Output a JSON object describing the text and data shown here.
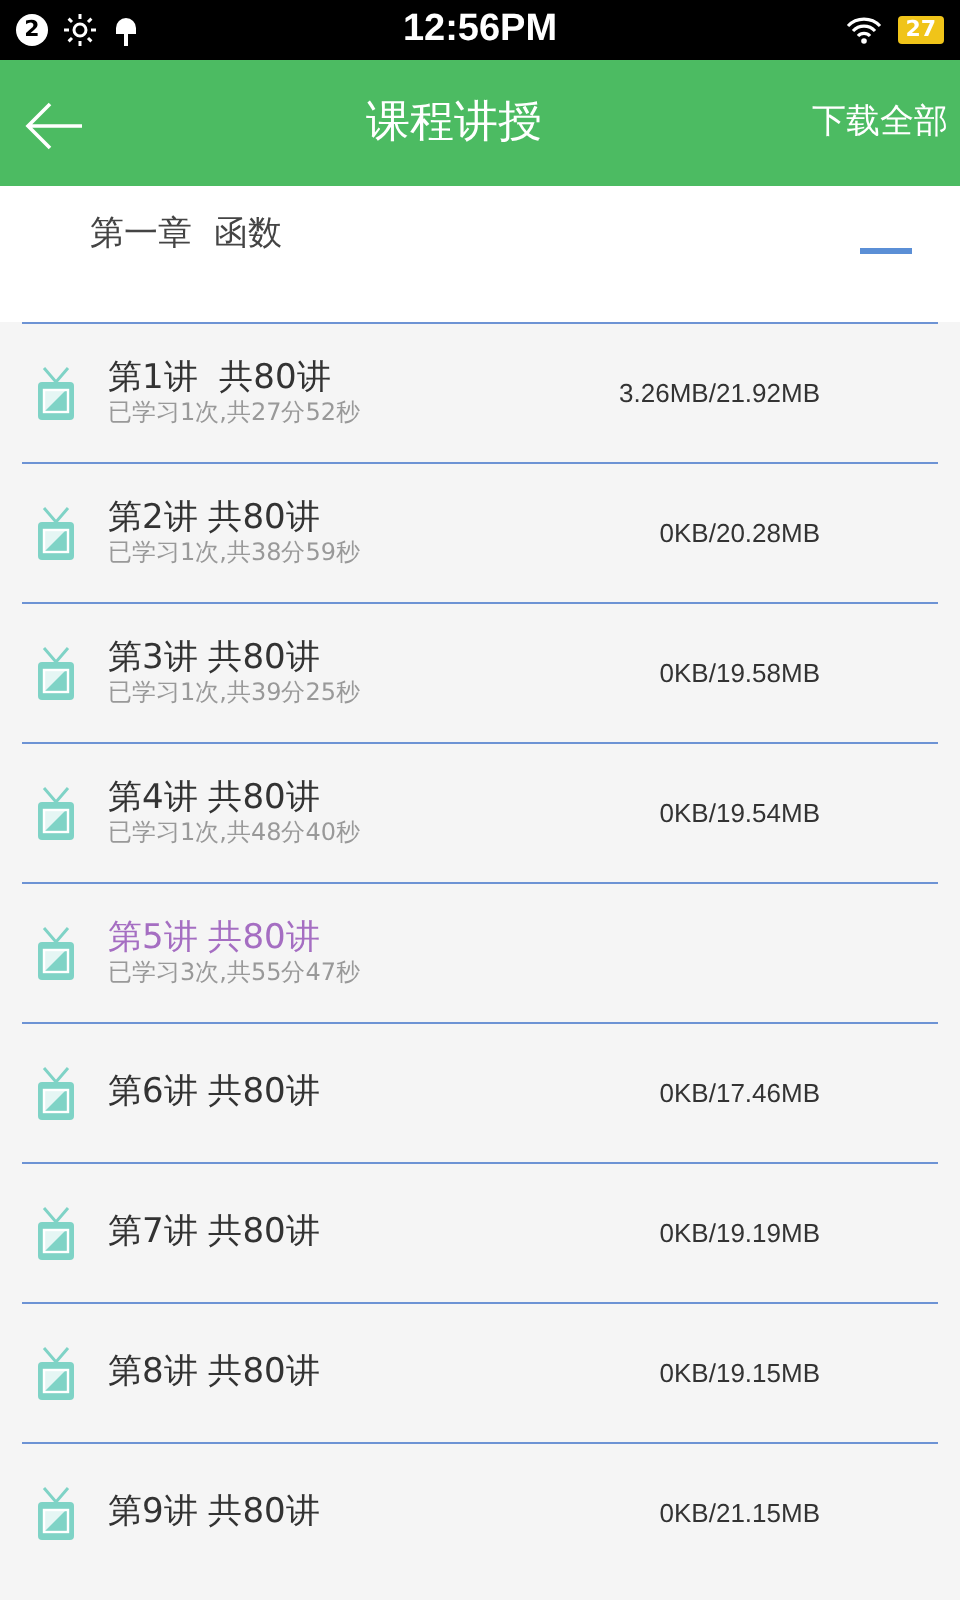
{
  "status_bar": {
    "notification_count": "2",
    "time": "12:56PM",
    "battery": "27"
  },
  "header": {
    "title": "课程讲授",
    "action": "下载全部"
  },
  "chapter": {
    "title": "第一章  函数",
    "expanded": true
  },
  "lessons": [
    {
      "title": "第1讲  共80讲",
      "progress": "已学习1次,共27分52秒",
      "size": "3.26MB/21.92MB",
      "selected": false
    },
    {
      "title": "第2讲 共80讲",
      "progress": "已学习1次,共38分59秒",
      "size": "0KB/20.28MB",
      "selected": false
    },
    {
      "title": "第3讲 共80讲",
      "progress": "已学习1次,共39分25秒",
      "size": "0KB/19.58MB",
      "selected": false
    },
    {
      "title": "第4讲 共80讲",
      "progress": "已学习1次,共48分40秒",
      "size": "0KB/19.54MB",
      "selected": false
    },
    {
      "title": "第5讲 共80讲",
      "progress": "已学习3次,共55分47秒",
      "selected": true
    },
    {
      "title": "第6讲 共80讲",
      "size": "0KB/17.46MB",
      "selected": false
    },
    {
      "title": "第7讲 共80讲",
      "size": "0KB/19.19MB",
      "selected": false
    },
    {
      "title": "第8讲 共80讲",
      "size": "0KB/19.15MB",
      "selected": false
    },
    {
      "title": "第9讲 共80讲",
      "size": "0KB/21.15MB",
      "selected": false
    }
  ]
}
